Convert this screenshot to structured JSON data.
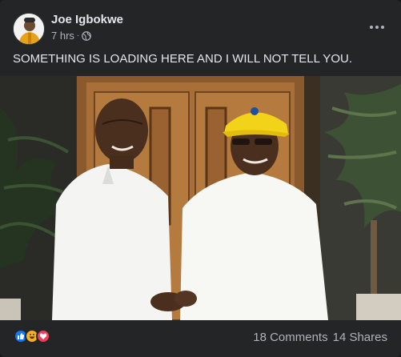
{
  "post": {
    "author": "Joe Igbokwe",
    "time": "7 hrs",
    "separator": "·",
    "privacy_icon": "globe-icon",
    "text": "SOMETHING IS LOADING HERE AND I WILL NOT TELL YOU.",
    "reactions": [
      "like-icon",
      "haha-icon",
      "love-icon"
    ],
    "comments": "18 Comments",
    "shares": "14 Shares"
  },
  "colors": {
    "background": "#242526",
    "text": "#e4e6eb",
    "secondary_text": "#b0b3b8",
    "like": "#1877f2",
    "love": "#f33e58",
    "haha": "#f7b125"
  }
}
